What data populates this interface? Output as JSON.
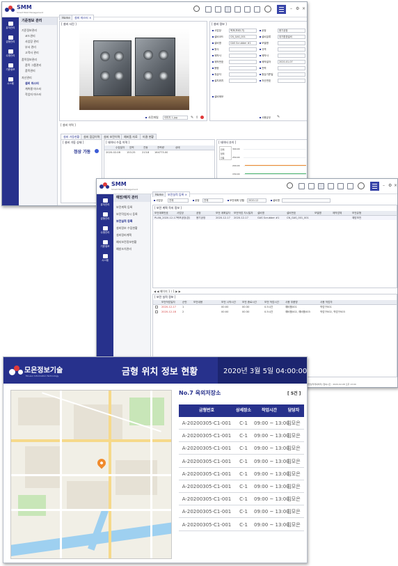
{
  "window1": {
    "brand": "SMM",
    "brand_sub": "Smart Mold Management",
    "sidebar": [
      {
        "label": "유지관리"
      },
      {
        "label": "금형관리"
      },
      {
        "label": "수명관리"
      },
      {
        "label": "기준정보"
      },
      {
        "label": "시스템"
      }
    ],
    "menu_title": "기준정보 관리",
    "menu": [
      "기준정보관리",
      "코드관리",
      "사업장 관리",
      "부서 관리",
      "고객사 관리",
      "품목정보관리",
      "품목 그룹관리",
      "품목관리",
      "자산관리",
      "설비 마스터",
      "계측평 마스터",
      "작업자 마스터"
    ],
    "tabs": [
      "Home",
      "설비 마스터"
    ],
    "photo_panel_title": "[ 설비 사진 ]",
    "photo_file_label": "사진파일",
    "photo_file_value": "이미지 1.jpg",
    "info_panel_title": "[ 설비 정보 ]",
    "info_fields": [
      {
        "label": "사업장",
        "value": "목포(모바1가)"
      },
      {
        "label": "설비코드",
        "value": "CN_GAS_001"
      },
      {
        "label": "설비명",
        "value": "GAS Scrubber #1"
      },
      {
        "label": "형식",
        "value": ""
      },
      {
        "label": "제작사",
        "value": ""
      },
      {
        "label": "제작번호",
        "value": ""
      },
      {
        "label": "용량",
        "value": ""
      },
      {
        "label": "취급자",
        "value": ""
      },
      {
        "label": "설치위치",
        "value": ""
      }
    ],
    "info_fields_right": [
      {
        "label": "공정",
        "value": "용기공정"
      },
      {
        "label": "설비분류",
        "value": "대기환경설비"
      },
      {
        "label": "모델명",
        "value": ""
      },
      {
        "label": "규격",
        "value": ""
      },
      {
        "label": "제작사",
        "value": ""
      },
      {
        "label": "제작일자",
        "value": "2020-01-07"
      },
      {
        "label": "전력",
        "value": ""
      },
      {
        "label": "점검기준일",
        "value": ""
      },
      {
        "label": "자산번호",
        "value": ""
      }
    ],
    "status_label": "사용유무",
    "lower_section_title": "[ 설비 이력 ]",
    "lower_tabs": [
      "설비 가동현황",
      "설비 점검이력",
      "설비 보전이력",
      "예비품 자료",
      "미결 현황"
    ],
    "state_panel_title": "[ 설비 가동 상태 ]",
    "state_badge": "정상 가동",
    "data_panel_title": "[ 데이터 수집 이력 ]",
    "data_columns": [
      "수집일자",
      "압력",
      "진동",
      "전력량",
      "상태"
    ],
    "data_row": [
      "2020-02-08",
      "153.25",
      "213.8",
      "164773.00",
      ""
    ],
    "chart_panel_title": "[ 데이터 추이 ]",
    "chart_legend": [
      "전력",
      "압력",
      "진동"
    ],
    "chart_ticks": [
      "300.00",
      "250.00",
      "200.00",
      "150.00",
      "100.00",
      "50.00"
    ]
  },
  "window2": {
    "brand": "SMM",
    "brand_sub": "Smart Mold Management",
    "sidebar": [
      {
        "label": "유지관리"
      },
      {
        "label": "금형관리"
      },
      {
        "label": "수명관리"
      },
      {
        "label": "기준정보"
      },
      {
        "label": "시스템"
      }
    ],
    "menu_title": "예방/예지 관리",
    "menu": [
      "보전계획 등록",
      "보전작업지시 등록",
      "보전실적 등록",
      "설비정보 수집현황",
      "설비정비계획",
      "예지보전정보현황",
      "예방조치관리"
    ],
    "tabs": [
      "Home",
      "보전실적 등록"
    ],
    "filters": [
      {
        "label": "사업장",
        "value": "전체"
      },
      {
        "label": "공정",
        "value": "전체"
      },
      {
        "label": "보전계획 년월",
        "value": "2020-12"
      },
      {
        "label": "설비명",
        "value": ""
      }
    ],
    "plan_panel_title": "[ 보전 계획 작지 정보 ]",
    "plan_columns": [
      "보전계획번호",
      "사업장",
      "공정",
      "보전 계획일자",
      "보전작업 지시일자",
      "설비명",
      "설비번호",
      "모델명",
      "제작업체",
      "보전유형"
    ],
    "plan_row": [
      "PLAN_2020-12-17_001",
      "목포공장(본)",
      "용기공정",
      "2020-12-17",
      "2020-12-17",
      "GAS Scrubber #1",
      "CN_GAS_001_001",
      "",
      "",
      "예방보전"
    ],
    "pager_text": "◀ ◀ 페이지 1 / 1 ▶ ▶",
    "result_panel_title": "[ 보전 실적 정보 ]",
    "result_columns": [
      "보전작업일자",
      "순번",
      "보전내용",
      "보전 시작시간",
      "보전 종료시간",
      "보전 작업시간",
      "사용 부품명",
      "사용 작업자"
    ],
    "result_rows": [
      [
        "2020-12-17",
        "1",
        "",
        "00:00",
        "00:30",
        "0.5시간",
        "예비품001",
        "작업구001"
      ],
      [
        "2020-12-18",
        "2",
        "",
        "00:00",
        "00:30",
        "0.5시간",
        "예비품002, 예비품003",
        "작업구002, 작업구003"
      ]
    ],
    "status_text": "[작업실적계획처리] 접속시간 : 2020-02-08 오후 13:00"
  },
  "board": {
    "logo_text": "모은정보기술",
    "logo_sub": "Mo-eun Information Technology",
    "title": "금형 위치 정보 현황",
    "datetime": "2020년 3월 5일 04:00:00",
    "location_title": "No.7 옥외저장소",
    "count": "[ 5건 ]",
    "columns": [
      "금형번호",
      "상세장소",
      "작업시간",
      "담당자"
    ],
    "rows": [
      [
        "A-20200305-C1-001",
        "C-1",
        "09:00 ~ 13:00",
        "김모은"
      ],
      [
        "A-20200305-C1-001",
        "C-1",
        "09:00 ~ 13:00",
        "김모은"
      ],
      [
        "A-20200305-C1-001",
        "C-1",
        "09:00 ~ 13:00",
        "김모은"
      ],
      [
        "A-20200305-C1-001",
        "C-1",
        "09:00 ~ 13:00",
        "김모은"
      ],
      [
        "A-20200305-C1-001",
        "C-1",
        "09:00 ~ 13:00",
        "김모은"
      ],
      [
        "A-20200305-C1-001",
        "C-1",
        "09:00 ~ 13:00",
        "김모은"
      ],
      [
        "A-20200305-C1-001",
        "C-1",
        "09:00 ~ 13:00",
        "김모은"
      ],
      [
        "A-20200305-C1-001",
        "C-1",
        "09:00 ~ 13:00",
        "김모은"
      ],
      [
        "A-20200305-C1-001",
        "C-1",
        "09:00 ~ 13:00",
        "김모은"
      ]
    ],
    "colors": {
      "brand": "#27318c",
      "marker": "#f08a2c"
    }
  }
}
